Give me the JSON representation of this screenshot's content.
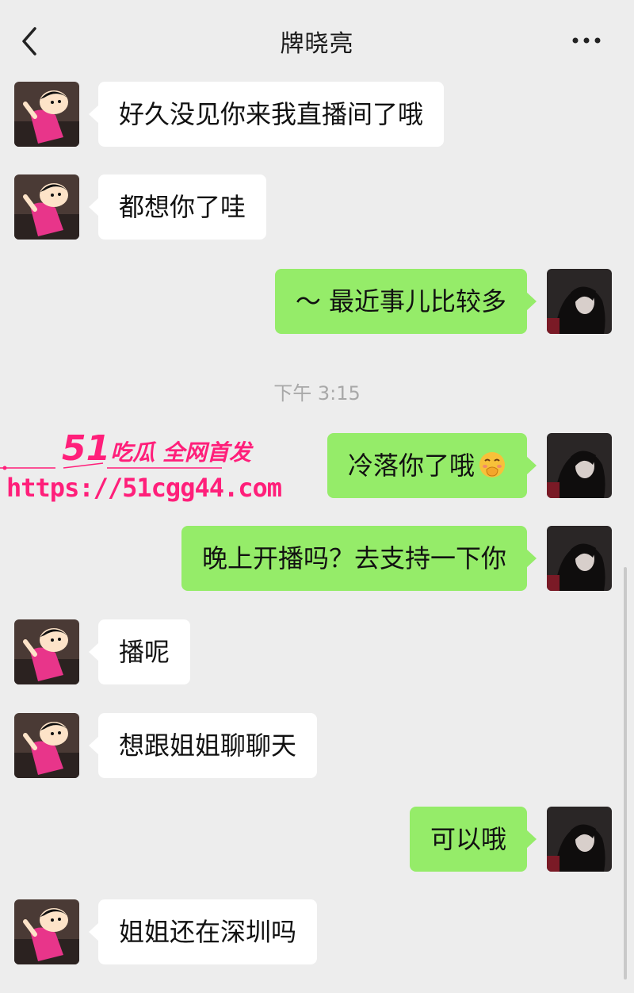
{
  "header": {
    "title": "牌晓亮",
    "back_icon": "chevron-left-icon",
    "more_icon": "ellipsis-icon"
  },
  "colors": {
    "background": "#ededed",
    "incoming_bubble": "#ffffff",
    "outgoing_bubble": "#95ec69",
    "timestamp": "#a8a8a8",
    "watermark": "#ff1f7a"
  },
  "messages": [
    {
      "side": "in",
      "text": "好久没见你来我直播间了哦"
    },
    {
      "side": "in",
      "text": "都想你了哇"
    },
    {
      "side": "out",
      "text": "～ 最近事儿比较多"
    },
    {
      "side": "out",
      "text": "冷落你了哦",
      "emoji": "hand-over-mouth-emoji"
    },
    {
      "side": "out",
      "text": "晚上开播吗？去支持一下你"
    },
    {
      "side": "in",
      "text": "播呢"
    },
    {
      "side": "in",
      "text": "想跟姐姐聊聊天"
    },
    {
      "side": "out",
      "text": "可以哦"
    },
    {
      "side": "in",
      "text": "姐姐还在深圳吗"
    }
  ],
  "timestamp": "下午 3:15",
  "watermark": {
    "brand_number": "51",
    "brand_text": "吃瓜 全网首发",
    "url": "https://51cgg44.com"
  }
}
